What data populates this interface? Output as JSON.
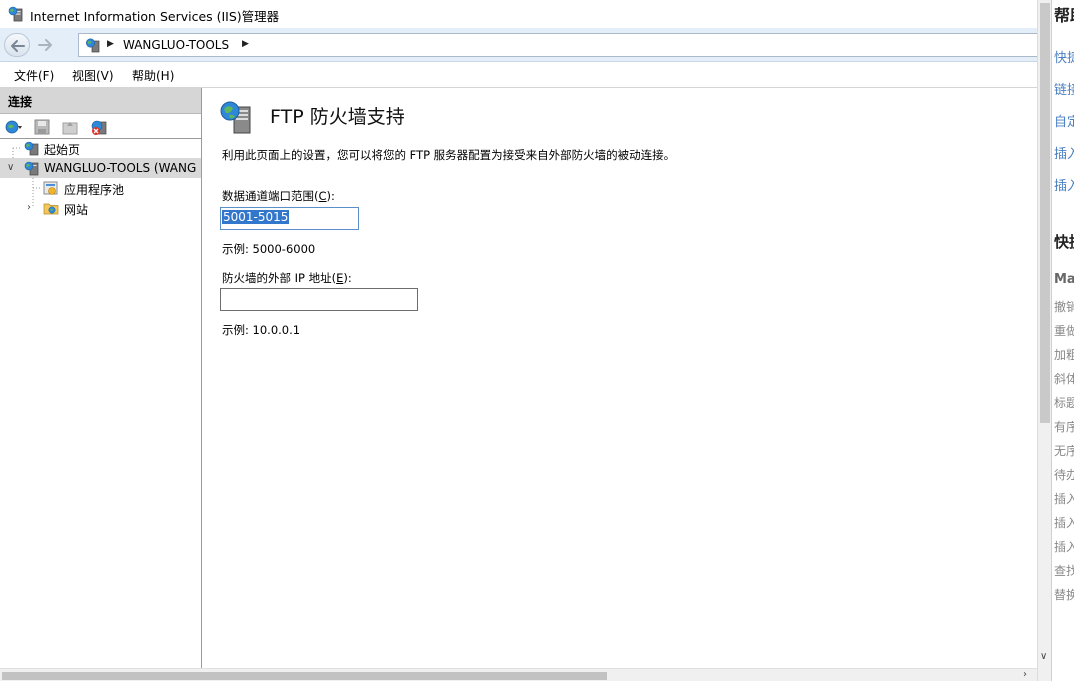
{
  "window": {
    "title": "Internet Information Services (IIS)管理器"
  },
  "address_bar": {
    "crumb": "WANGLUO-TOOLS"
  },
  "menu": {
    "file": "文件(F)",
    "view": "视图(V)",
    "help": "帮助(H)"
  },
  "connections": {
    "header": "连接",
    "tree": {
      "start_page": "起始页",
      "server": "WANGLUO-TOOLS (WANG",
      "app_pools": "应用程序池",
      "sites": "网站"
    }
  },
  "feature": {
    "title": "FTP 防火墙支持",
    "description": "利用此页面上的设置，您可以将您的 FTP 服务器配置为接受来自外部防火墙的被动连接。",
    "port_range_label_pre": "数据通道端口范围(",
    "port_range_label_key": "C",
    "port_range_label_post": "):",
    "port_range_value": "5001-5015",
    "port_range_example": "示例: 5000-6000",
    "external_ip_label_pre": "防火墙的外部 IP 地址(",
    "external_ip_label_key": "E",
    "external_ip_label_post": "):",
    "external_ip_value": "",
    "external_ip_example": "示例: 10.0.0.1"
  },
  "help_panel": {
    "title": "帮助",
    "links": [
      "快捷",
      "链接",
      "自定",
      "插入",
      "插入"
    ],
    "section": "快捷",
    "subsection": "Ma",
    "items": [
      "撤销",
      "重做",
      "加粗",
      "斜体",
      "标题",
      "有序",
      "无序",
      "待办",
      "插入",
      "插入",
      "插入",
      "查找",
      "替换"
    ]
  },
  "colors": {
    "address_bar_bg": "#e4eef9",
    "selection": "#3377cc",
    "pane_header_bg": "#d6d6d6",
    "help_link": "#4a7fc0"
  },
  "icons": [
    "iis-app-icon",
    "back-arrow-icon",
    "forward-arrow-icon",
    "globe-server-icon",
    "connect-icon",
    "save-icon",
    "disconnect-icon",
    "server-icon",
    "apppool-icon",
    "sites-folder-icon",
    "ftp-firewall-icon"
  ]
}
